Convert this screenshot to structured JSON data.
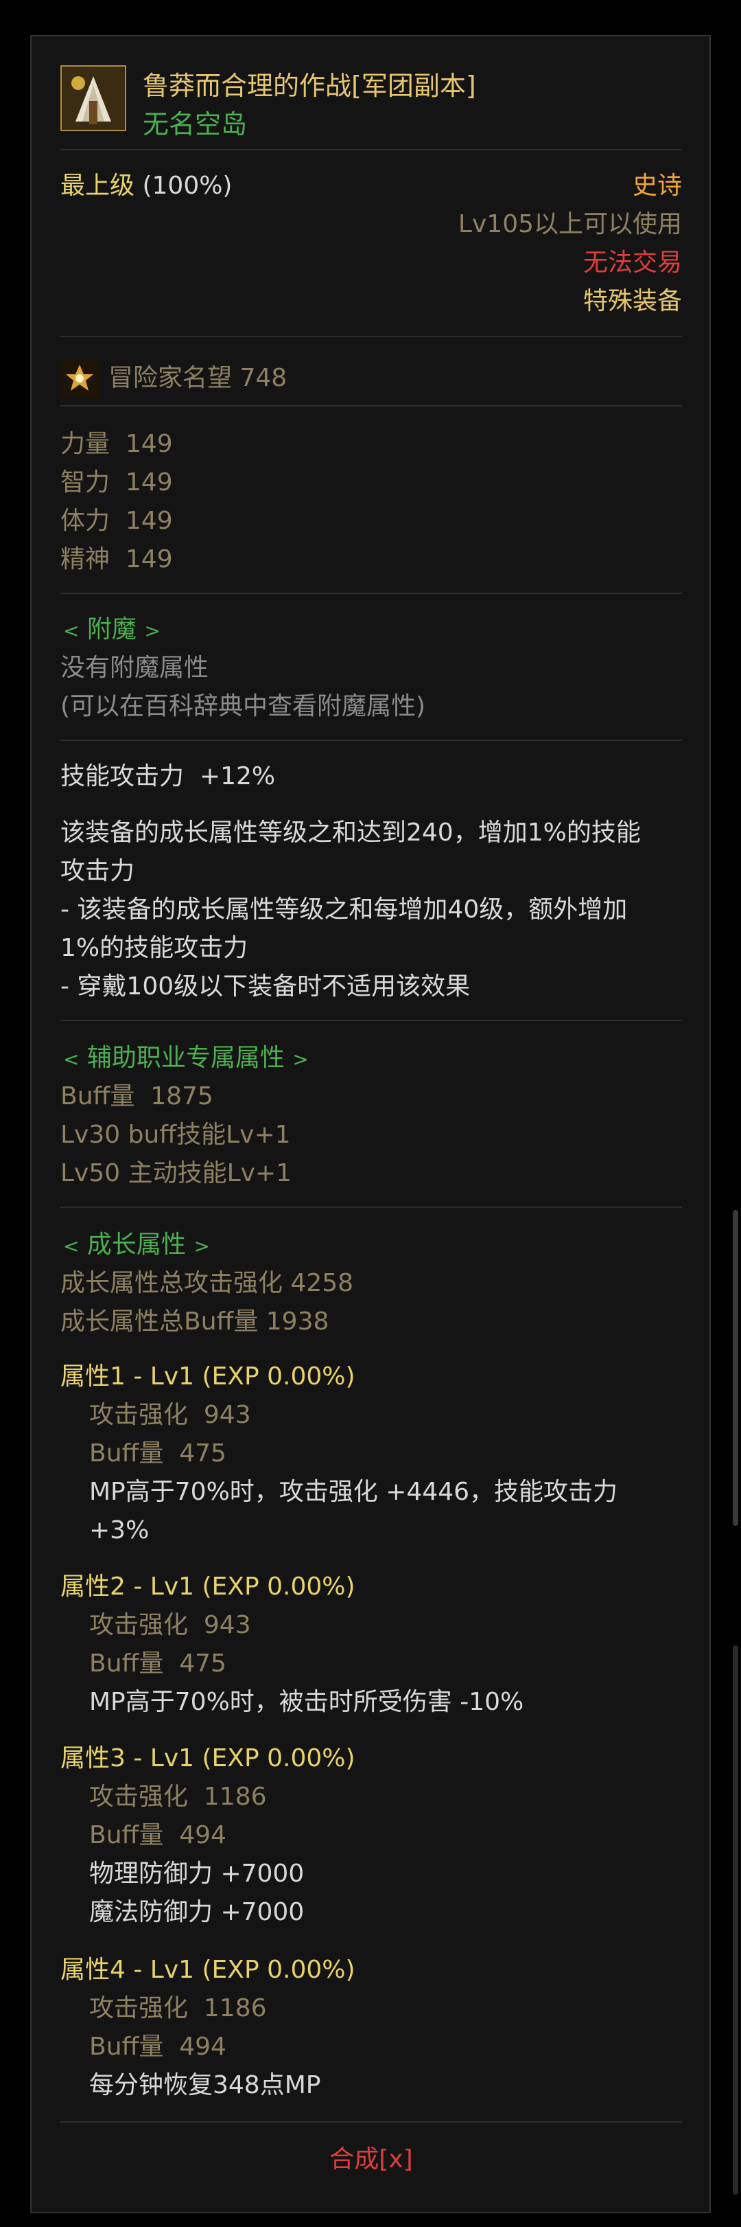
{
  "item": {
    "name": "鲁莽而合理的作战[军团副本]",
    "source": "无名空岛",
    "grade_label": "最上级",
    "grade_value": "(100%)",
    "rarity": "史诗",
    "level_req": "Lv105以上可以使用",
    "trade": "无法交易",
    "type": "特殊装备"
  },
  "fame": {
    "label": "冒险家名望",
    "value": "748"
  },
  "stats": [
    {
      "name": "力量",
      "value": "149"
    },
    {
      "name": "智力",
      "value": "149"
    },
    {
      "name": "体力",
      "value": "149"
    },
    {
      "name": "精神",
      "value": "149"
    }
  ],
  "enchant": {
    "header": "附魔",
    "none": "没有附魔属性",
    "hint": "(可以在百科辞典中查看附魔属性)"
  },
  "skill_attack": {
    "label": "技能攻击力",
    "value": "+12%",
    "desc": [
      "该装备的成长属性等级之和达到240，增加1%的技能",
      "攻击力",
      "- 该装备的成长属性等级之和每增加40级，额外增加",
      "1%的技能攻击力",
      "- 穿戴100级以下装备时不适用该效果"
    ]
  },
  "support": {
    "header": "辅助职业专属属性",
    "buff_label": "Buff量",
    "buff_value": "1875",
    "line1": "Lv30 buff技能Lv+1",
    "line2": "Lv50 主动技能Lv+1"
  },
  "growth": {
    "header": "成长属性",
    "total_attack": "成长属性总攻击强化 4258",
    "total_buff": "成长属性总Buff量 1938",
    "attrs": [
      {
        "title": "属性1 - Lv1 (EXP 0.00%)",
        "atk_label": "攻击强化",
        "atk": "943",
        "buff_label": "Buff量",
        "buff": "475",
        "effects": [
          "MP高于70%时，攻击强化 +4446，技能攻击力",
          "+3%"
        ]
      },
      {
        "title": "属性2 - Lv1 (EXP 0.00%)",
        "atk_label": "攻击强化",
        "atk": "943",
        "buff_label": "Buff量",
        "buff": "475",
        "effects": [
          "MP高于70%时，被击时所受伤害 -10%"
        ]
      },
      {
        "title": "属性3 - Lv1 (EXP 0.00%)",
        "atk_label": "攻击强化",
        "atk": "1186",
        "buff_label": "Buff量",
        "buff": "494",
        "effects": [
          "物理防御力 +7000",
          "魔法防御力 +7000"
        ]
      },
      {
        "title": "属性4 - Lv1 (EXP 0.00%)",
        "atk_label": "攻击强化",
        "atk": "1186",
        "buff_label": "Buff量",
        "buff": "494",
        "effects": [
          "每分钟恢复348点MP"
        ]
      }
    ]
  },
  "synthesize": "合成[x]",
  "colors": {
    "background": "#141414",
    "name": "#e6c66e",
    "source": "#4caf50",
    "rarity": "#f2a63a",
    "untradable": "#e03e3e",
    "stat": "#8b8b8b",
    "attr_title": "#e8d36b"
  }
}
